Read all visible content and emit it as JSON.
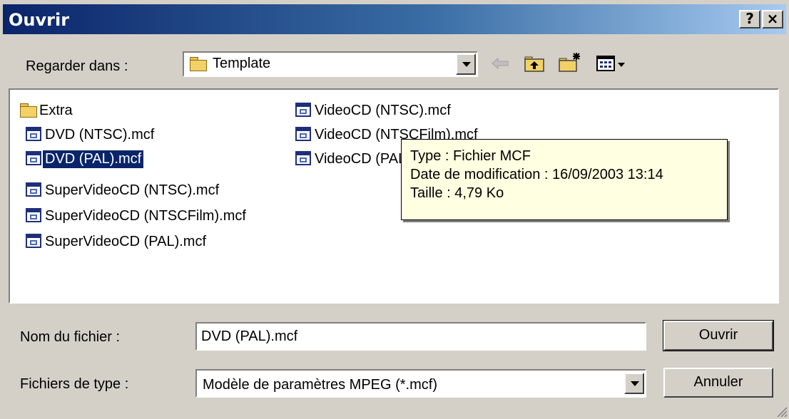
{
  "window": {
    "title": "Ouvrir",
    "help_label": "?",
    "close_label": "×"
  },
  "look_in": {
    "label": "Regarder dans :",
    "value": "Template"
  },
  "toolbar": {
    "back_icon": "back-arrow-icon",
    "up_icon": "up-folder-icon",
    "new_folder_icon": "new-folder-icon",
    "view_menu_icon": "view-menu-icon"
  },
  "files": [
    {
      "name": "Extra",
      "icon": "folder-icon"
    },
    {
      "name": "DVD (NTSC).mcf",
      "icon": "mcf-file-icon"
    },
    {
      "name": "DVD (PAL).mcf",
      "icon": "mcf-file-icon",
      "selected": true
    },
    {
      "name": "SuperVideoCD (NTSC).mcf",
      "icon": "mcf-file-icon"
    },
    {
      "name": "SuperVideoCD (NTSCFilm).mcf",
      "icon": "mcf-file-icon"
    },
    {
      "name": "SuperVideoCD (PAL).mcf",
      "icon": "mcf-file-icon"
    },
    {
      "name": "VideoCD (NTSC).mcf",
      "icon": "mcf-file-icon"
    },
    {
      "name": "VideoCD (NTSCFilm).mcf",
      "icon": "mcf-file-icon"
    },
    {
      "name": "VideoCD (PAL).mcf",
      "icon": "mcf-file-icon"
    }
  ],
  "tooltip": {
    "type_line": "Type : Fichier MCF",
    "date_line": "Date de modification : 16/09/2003 13:14",
    "size_line": "Taille  : 4,79 Ko"
  },
  "filename": {
    "label": "Nom du fichier :",
    "value": "DVD (PAL).mcf"
  },
  "filetype": {
    "label": "Fichiers de type :",
    "value": "Modèle de paramètres MPEG (*.mcf)"
  },
  "buttons": {
    "open_label": "Ouvrir",
    "cancel_label": "Annuler"
  },
  "colors": {
    "titlebar_start": "#0a246a",
    "titlebar_end": "#a6caf0",
    "face": "#d4d0c8",
    "selection": "#0a246a",
    "tooltip_bg": "#ffffe1"
  }
}
